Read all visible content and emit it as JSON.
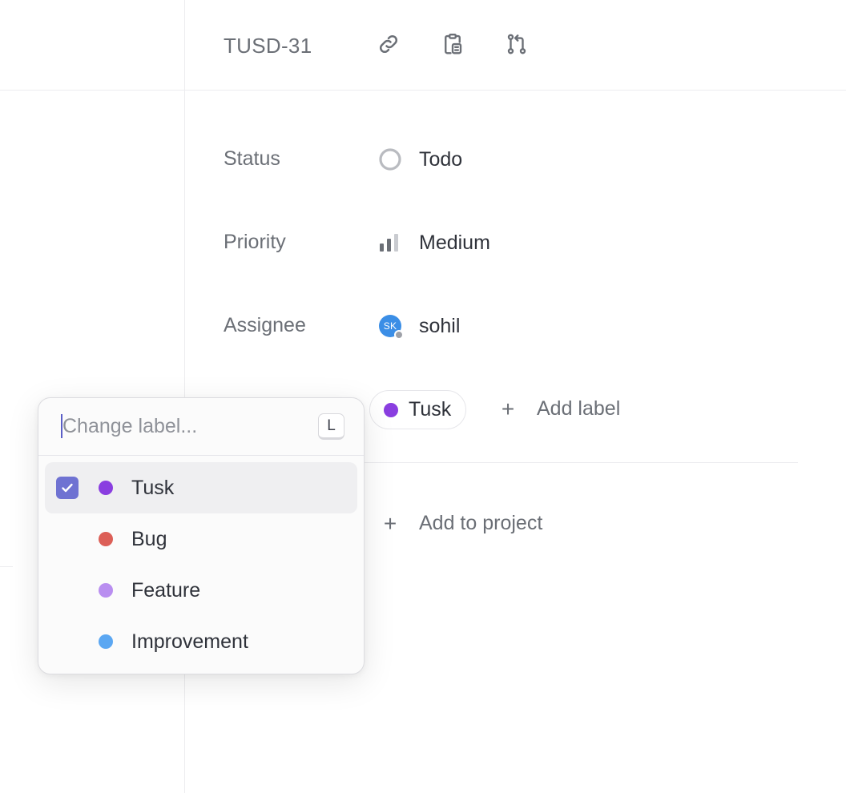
{
  "header": {
    "issue_id": "TUSD-31",
    "icons": [
      "link-icon",
      "clipboard-icon",
      "branch-icon"
    ]
  },
  "properties": {
    "status": {
      "label": "Status",
      "value": "Todo",
      "icon": "todo-circle-icon"
    },
    "priority": {
      "label": "Priority",
      "value": "Medium",
      "icon": "priority-bars-icon"
    },
    "assignee": {
      "label": "Assignee",
      "value": "sohil",
      "initials": "SK",
      "avatar_color": "#3b8ee6"
    },
    "labels": {
      "current": {
        "name": "Tusk",
        "color": "#8a3ee0"
      },
      "add_label": "Add label"
    },
    "project": {
      "add_label": "Add to project"
    }
  },
  "label_popover": {
    "search_placeholder": "Change label...",
    "shortcut": "L",
    "items": [
      {
        "name": "Tusk",
        "color": "#8a3ee0",
        "checked": true
      },
      {
        "name": "Bug",
        "color": "#dc5f57",
        "checked": false
      },
      {
        "name": "Feature",
        "color": "#b98ef0",
        "checked": false
      },
      {
        "name": "Improvement",
        "color": "#5ba7f2",
        "checked": false
      }
    ]
  },
  "colors": {
    "accent": "#6f72d2",
    "border": "#ececef",
    "muted_text": "#6b6f76"
  }
}
